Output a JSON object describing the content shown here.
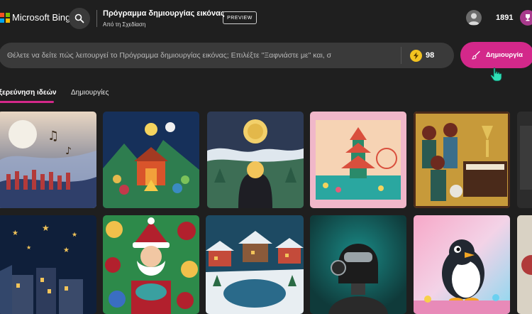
{
  "header": {
    "brand": "Microsoft Bing",
    "title": "Πρόγραμμα δημιουργίας εικόνας",
    "subtitle": "Από τη Σχεδίαση",
    "preview_label": "PREVIEW",
    "points": "1891",
    "icons": {
      "search": "search-icon",
      "avatar": "avatar-icon",
      "rewards": "trophy-icon"
    }
  },
  "prompt": {
    "placeholder": "Θέλετε να δείτε πώς λειτουργεί το Πρόγραμμα δημιουργίας εικόνας; Επιλέξτε \"Ξαφνιάστε με\" και, σ",
    "boosts": "98",
    "create_label": "Δημιουργία",
    "accent": "#d3288a"
  },
  "tabs": [
    {
      "label": "Εξερεύνηση ιδεών",
      "active": true
    },
    {
      "label": "Δημιουργίες",
      "active": false
    }
  ],
  "gallery": [
    {
      "name": "orchestra-dreamscape",
      "palette": [
        "#e9d7c3",
        "#b33a3a",
        "#3b4f7a"
      ]
    },
    {
      "name": "papercut-campfire",
      "palette": [
        "#16305a",
        "#d9542b",
        "#2e7d4f"
      ]
    },
    {
      "name": "moonlit-papercut-village",
      "palette": [
        "#2d3a54",
        "#f2d06b",
        "#3d6e55"
      ]
    },
    {
      "name": "paper-pagoda-diorama",
      "palette": [
        "#f0b7c9",
        "#2aa7a0",
        "#d94f3d"
      ]
    },
    {
      "name": "women-at-piano-mosaic",
      "palette": [
        "#c79a3a",
        "#2a5a52",
        "#6d2a1f"
      ]
    },
    {
      "name": "starry-night-town",
      "palette": [
        "#0f1f3a",
        "#f2c45a",
        "#33476b"
      ]
    },
    {
      "name": "santa-with-ornaments",
      "palette": [
        "#b2202d",
        "#2d8a4a",
        "#f1c04b"
      ]
    },
    {
      "name": "snowy-village-pond",
      "palette": [
        "#1d4a63",
        "#e8eef2",
        "#c44b3a"
      ]
    },
    {
      "name": "robot-portrait",
      "palette": [
        "#0f5a58",
        "#1c1c1c",
        "#9aa3a8"
      ]
    },
    {
      "name": "cartoon-penguin",
      "palette": [
        "#f3d3e7",
        "#222831",
        "#f5a623"
      ]
    }
  ]
}
